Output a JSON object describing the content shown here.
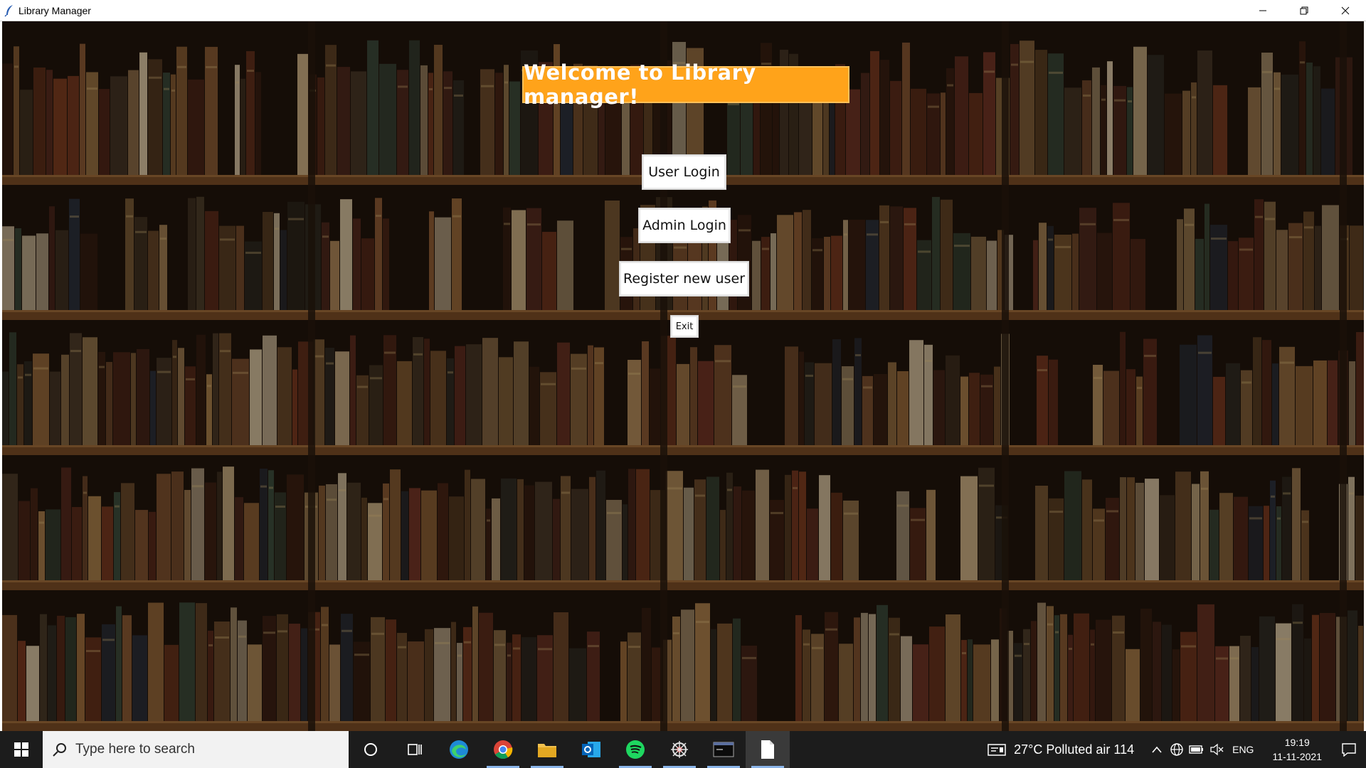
{
  "window": {
    "title": "Library Manager",
    "minimize_icon": "minimize-icon",
    "maximize_icon": "restore-icon",
    "close_icon": "close-icon"
  },
  "main": {
    "welcome": "Welcome to Library manager!",
    "buttons": {
      "user_login": "User Login",
      "admin_login": "Admin Login",
      "register": "Register new user",
      "exit": "Exit"
    },
    "colors": {
      "welcome_bg": "#ffa31a",
      "welcome_text": "#ffffff",
      "button_bg": "#ffffff"
    },
    "background": "bookshelf-photo"
  },
  "taskbar": {
    "search_placeholder": "Type here to search",
    "apps": [
      "cortana",
      "task-view",
      "edge",
      "chrome",
      "file-explorer",
      "outlook",
      "spotify",
      "kali-tool",
      "mysql-console",
      "notepad"
    ],
    "weather": "27°C  Polluted air 114",
    "language": "ENG",
    "time": "19:19",
    "date": "11-11-2021"
  }
}
